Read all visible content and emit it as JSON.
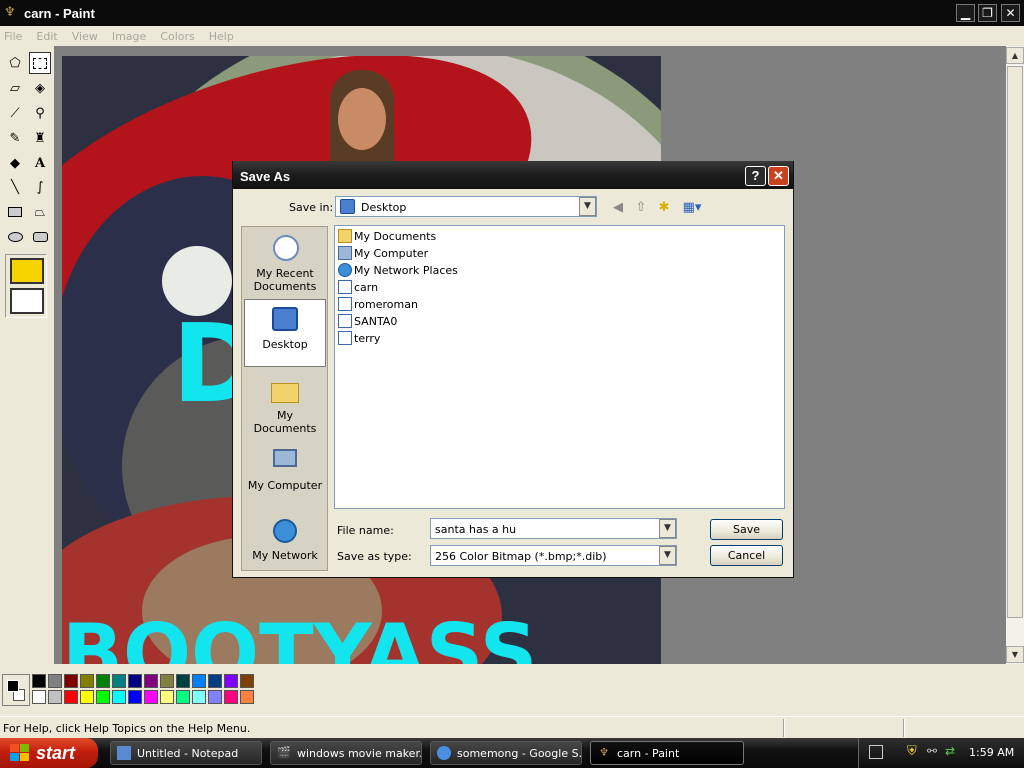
{
  "window": {
    "title": "carn - Paint",
    "min": "▁",
    "max": "❐",
    "close": "✕"
  },
  "menu": [
    "File",
    "Edit",
    "View",
    "Image",
    "Colors",
    "Help"
  ],
  "canvas_text": {
    "big1": "D",
    "big2": "BOOTYASS"
  },
  "palette": {
    "row1": [
      "#000000",
      "#808080",
      "#800000",
      "#808000",
      "#008000",
      "#008080",
      "#000080",
      "#800080",
      "#808040",
      "#004040",
      "#0080ff",
      "#004080",
      "#8000ff",
      "#804000"
    ],
    "row2": [
      "#ffffff",
      "#c0c0c0",
      "#ff0000",
      "#ffff00",
      "#00ff00",
      "#00ffff",
      "#0000ff",
      "#ff00ff",
      "#ffff80",
      "#00ff80",
      "#80ffff",
      "#8080ff",
      "#ff0080",
      "#ff8040"
    ]
  },
  "status": {
    "text": "For Help, click Help Topics on the Help Menu."
  },
  "taskbar": {
    "start": "start",
    "items": [
      {
        "label": "Untitled - Notepad",
        "icon": "notepad-icon"
      },
      {
        "label": "windows movie maker...",
        "icon": "movie-maker-icon"
      },
      {
        "label": "somemong - Google S...",
        "icon": "chrome-icon"
      },
      {
        "label": "carn - Paint",
        "icon": "paint-icon"
      }
    ],
    "clock": "1:59 AM"
  },
  "dialog": {
    "title": "Save As",
    "help": "?",
    "close": "✕",
    "save_in_label": "Save in:",
    "save_in_value": "Desktop",
    "places": [
      {
        "label": "My Recent Documents",
        "icon": "recent-documents-icon"
      },
      {
        "label": "Desktop",
        "icon": "desktop-icon"
      },
      {
        "label": "My Documents",
        "icon": "my-documents-icon"
      },
      {
        "label": "My Computer",
        "icon": "my-computer-icon"
      },
      {
        "label": "My Network",
        "icon": "my-network-icon"
      }
    ],
    "files": [
      {
        "name": "My Documents",
        "icon": "folder-icon"
      },
      {
        "name": "My Computer",
        "icon": "computer-icon"
      },
      {
        "name": "My Network Places",
        "icon": "network-icon"
      },
      {
        "name": "carn",
        "icon": "bitmap-file-icon"
      },
      {
        "name": "romeroman",
        "icon": "bitmap-file-icon"
      },
      {
        "name": "SANTA0",
        "icon": "bitmap-file-icon"
      },
      {
        "name": "terry",
        "icon": "bitmap-file-icon"
      }
    ],
    "file_name_label": "File name:",
    "file_name_value": "santa has a hu",
    "save_type_label": "Save as type:",
    "save_type_value": "256 Color Bitmap (*.bmp;*.dib)",
    "save_button": "Save",
    "cancel_button": "Cancel"
  }
}
